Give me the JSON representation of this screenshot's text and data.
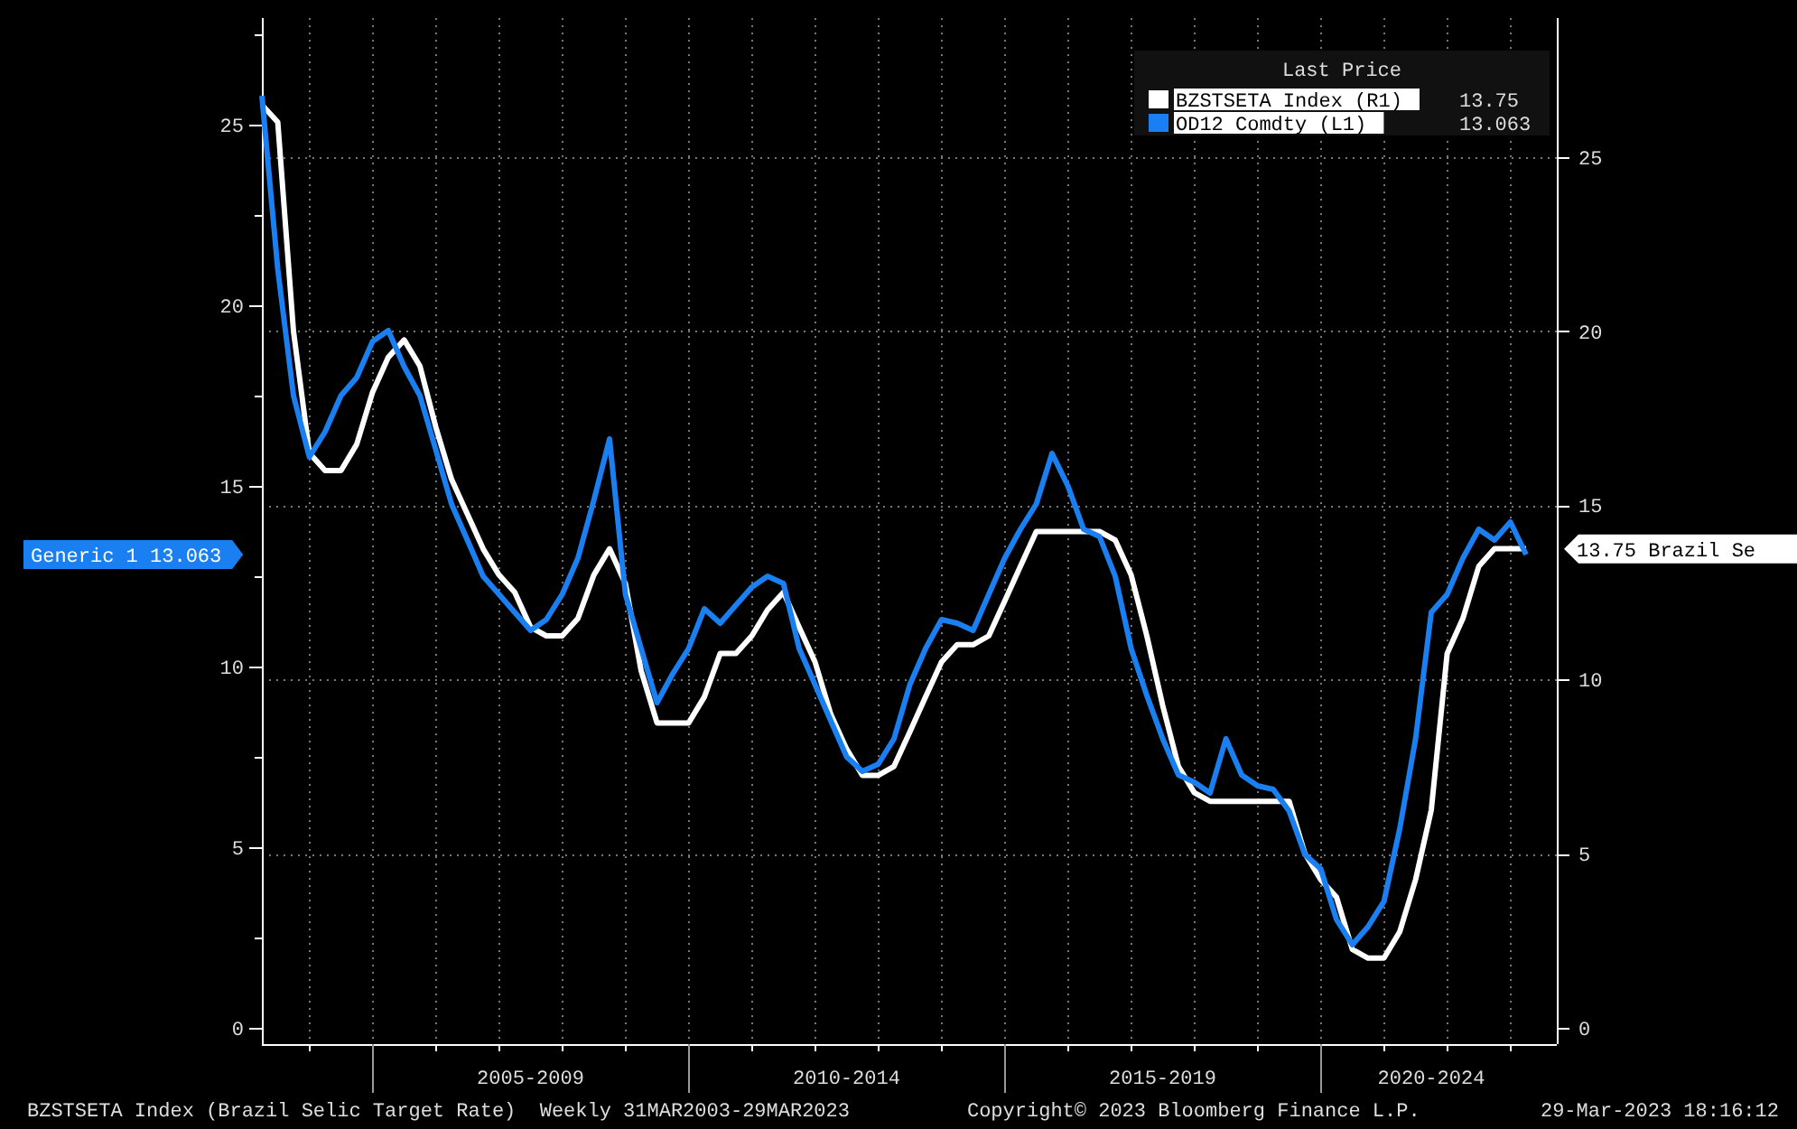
{
  "chart": {
    "chart_data": {
      "type": "line",
      "categories": [
        null,
        null,
        null,
        null,
        null,
        null,
        null,
        null,
        null,
        null,
        null,
        null,
        null,
        null,
        null,
        null,
        null,
        "2005-2009",
        null,
        null,
        null,
        null,
        null,
        null,
        null,
        null,
        null,
        null,
        null,
        null,
        null,
        null,
        null,
        null,
        null,
        null,
        null,
        "2010-2014",
        null,
        null,
        null,
        null,
        null,
        null,
        null,
        null,
        null,
        null,
        null,
        null,
        null,
        null,
        null,
        null,
        null,
        null,
        null,
        "2015-2019",
        null,
        null,
        null,
        null,
        null,
        null,
        null,
        null,
        null,
        null,
        null,
        null,
        null,
        null,
        null,
        null,
        "2020-2024",
        null,
        null,
        null,
        null,
        null,
        null
      ],
      "series": [
        {
          "name": "BZSTSETA Index  (R1)",
          "color": "#ffffff",
          "axis": "y2",
          "values": [
            26.5,
            26,
            20,
            16.5,
            16,
            16,
            16.75,
            18.25,
            19.25,
            19.75,
            19,
            17.25,
            15.75,
            14.75,
            13.75,
            13,
            12.5,
            11.5,
            11.25,
            11.25,
            11.75,
            13,
            13.75,
            12.75,
            10.25,
            8.75,
            8.75,
            8.75,
            9.5,
            10.75,
            10.75,
            11.25,
            12,
            12.5,
            11.5,
            10.5,
            9,
            8,
            7.25,
            7.25,
            7.5,
            8.5,
            9.5,
            10.5,
            11,
            11,
            11.25,
            12.25,
            13.25,
            14.25,
            14.25,
            14.25,
            14.25,
            14.25,
            14,
            13,
            11.25,
            9.25,
            7.5,
            6.75,
            6.5,
            6.5,
            6.5,
            6.5,
            6.5,
            6.5,
            5,
            4.25,
            3.75,
            2.25,
            2,
            2,
            2.75,
            4.25,
            6.25,
            10.75,
            11.75,
            13.25,
            13.75,
            13.75,
            13.75
          ]
        },
        {
          "name": "OD12 Comdty  (L1)",
          "color": "#1a7ff0",
          "values": [
            25.8,
            21,
            17.5,
            15.8,
            16.5,
            17.5,
            18,
            19,
            19.3,
            18.3,
            17.5,
            16,
            14.5,
            13.5,
            12.5,
            12,
            11.5,
            11,
            11.3,
            12,
            13,
            14.6,
            16.3,
            12,
            10.5,
            9,
            9.8,
            10.5,
            11.6,
            11.2,
            11.7,
            12.2,
            12.5,
            12.3,
            10.5,
            9.5,
            8.5,
            7.5,
            7.1,
            7.3,
            8,
            9.5,
            10.5,
            11.3,
            11.2,
            11,
            12,
            13,
            13.8,
            14.5,
            15.9,
            15,
            13.8,
            13.6,
            12.5,
            10.5,
            9.2,
            8,
            7,
            6.8,
            6.5,
            8,
            7,
            6.7,
            6.6,
            6,
            4.8,
            4.4,
            3,
            2.3,
            2.8,
            3.5,
            5.5,
            8,
            11.5,
            12,
            13,
            13.8,
            13.5,
            14,
            13.1
          ]
        }
      ],
      "ylim": [
        -0.45,
        27.95
      ],
      "yticks": [
        0,
        5,
        10,
        15,
        20,
        25
      ],
      "y2lim": [
        -0.47,
        28.99
      ],
      "y2ticks": [
        0,
        5,
        10,
        15,
        20,
        25
      ],
      "grid": true,
      "legend": "upper right"
    },
    "legend_title": "Last Price",
    "legend_values": [
      "13.75",
      "13.063"
    ],
    "value_tags": [
      {
        "kind": "left",
        "text": "Generic 1 13.063"
      },
      {
        "kind": "right",
        "text": "13.75 Brazil Se"
      }
    ]
  },
  "footer": {
    "title": "BZSTSETA Index (Brazil Selic Target Rate)  Weekly 31MAR2003-29MAR2023",
    "copyright": "Copyright© 2023 Bloomberg Finance L.P.",
    "timestamp": "29-Mar-2023 18:16:12"
  }
}
